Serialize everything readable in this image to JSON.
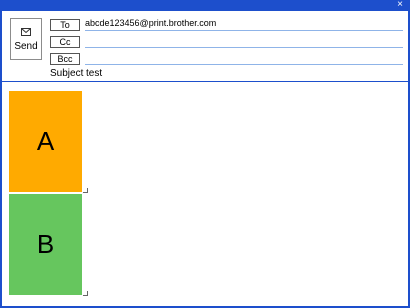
{
  "window": {
    "title_bar_color": "#1d4fcc",
    "close_glyph": "×"
  },
  "send": {
    "label": "Send",
    "icon": "envelope-icon"
  },
  "recipients": {
    "to_label": "To",
    "to_value": "abcde123456@print.brother.com",
    "cc_label": "Cc",
    "cc_value": "",
    "bcc_label": "Bcc",
    "bcc_value": ""
  },
  "subject": {
    "label": "Subject",
    "value": "test"
  },
  "attachments": [
    {
      "label": "A",
      "color": "#ffaa00"
    },
    {
      "label": "B",
      "color": "#66c65e"
    }
  ]
}
